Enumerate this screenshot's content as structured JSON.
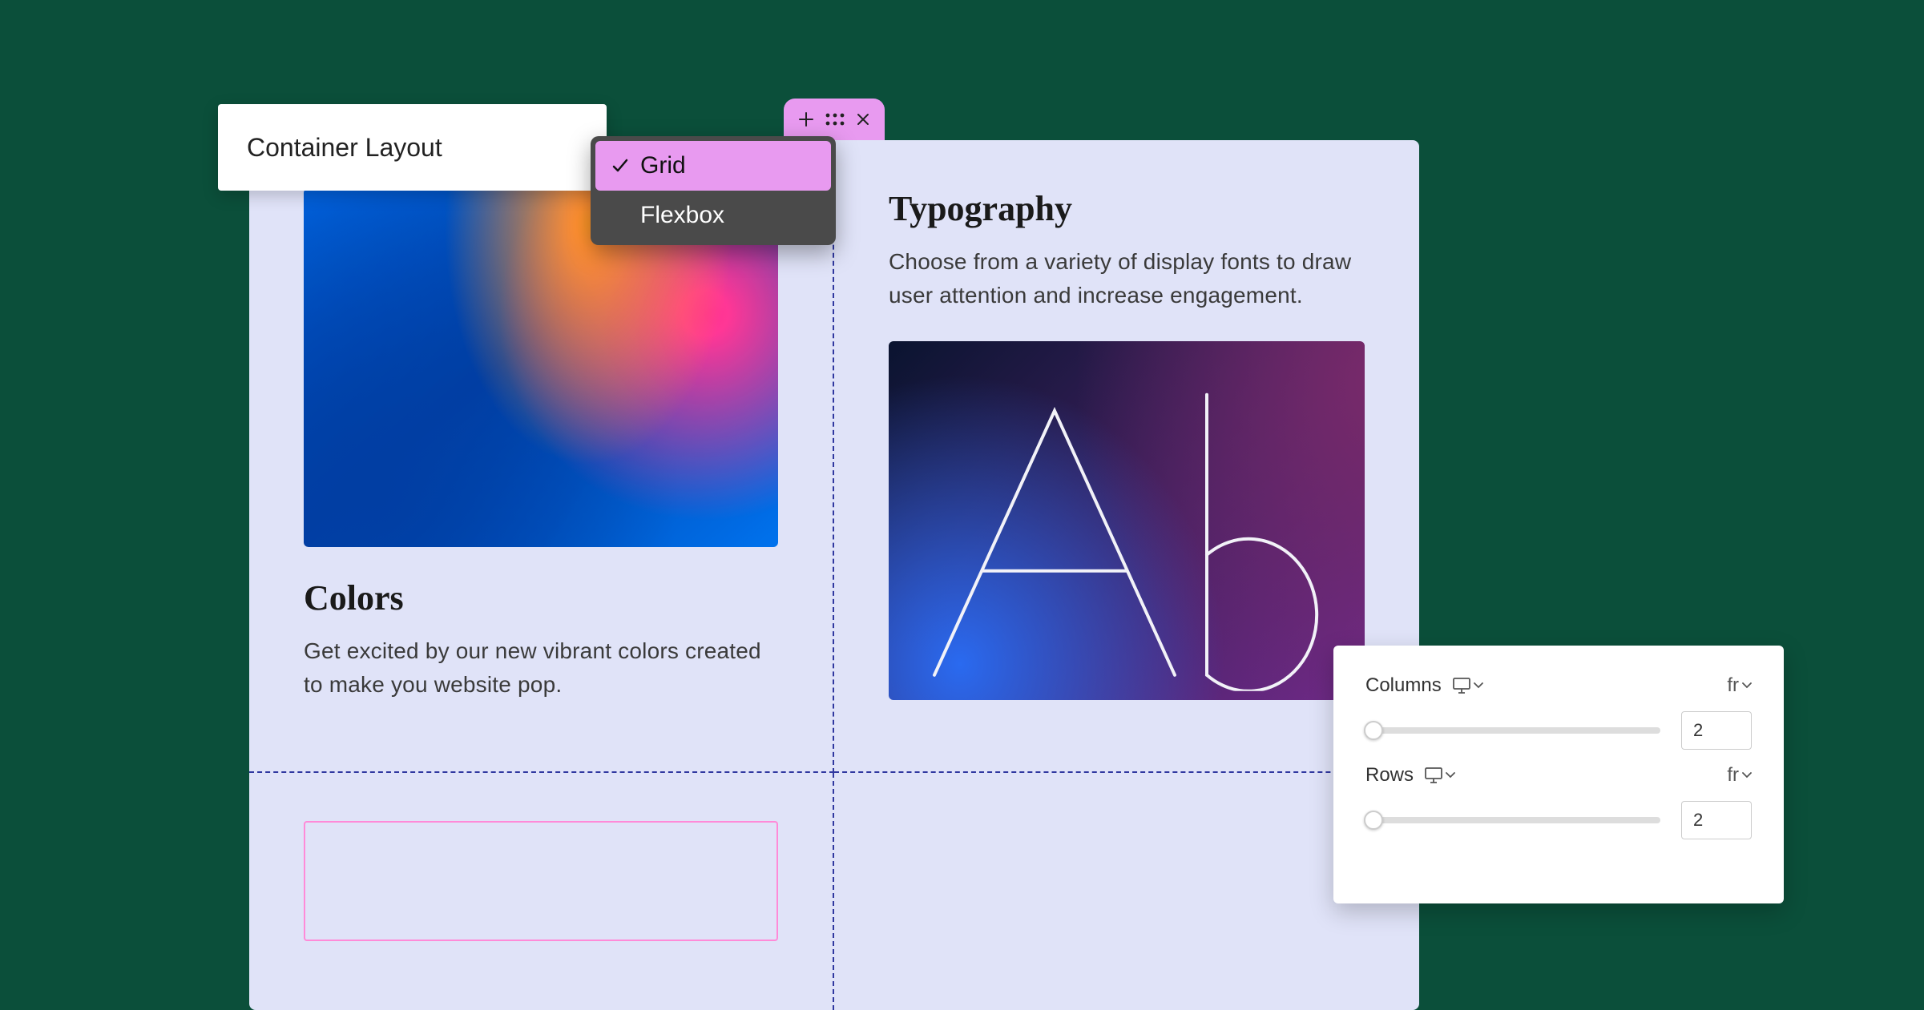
{
  "layoutPanel": {
    "title": "Container Layout"
  },
  "menu": {
    "items": [
      {
        "label": "Grid",
        "selected": true
      },
      {
        "label": "Flexbox",
        "selected": false
      }
    ]
  },
  "tab": {
    "icons": [
      "plus",
      "drag",
      "close"
    ]
  },
  "cards": {
    "colors": {
      "heading": "Colors",
      "body": "Get excited by our new vibrant colors created to make you website pop."
    },
    "typography": {
      "heading": "Typography",
      "body": "Choose from a variety of display fonts to draw user attention and increase engagement.",
      "sampleGlyph": "Ab"
    }
  },
  "settings": {
    "columns": {
      "label": "Columns",
      "unit": "fr",
      "value": "2"
    },
    "rows": {
      "label": "Rows",
      "unit": "fr",
      "value": "2"
    }
  }
}
